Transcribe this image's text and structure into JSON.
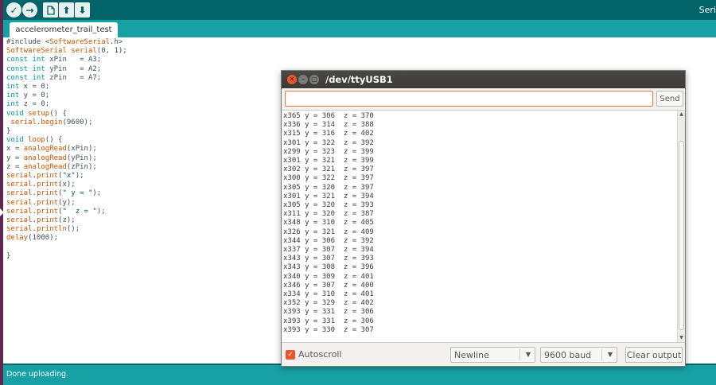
{
  "window": {
    "title_fragment": "Seri"
  },
  "toolbar": {
    "verify_icon": "check-icon",
    "upload_icon": "arrow-right-icon",
    "new_icon": "new-file-icon",
    "open_icon": "arrow-up-icon",
    "save_icon": "arrow-down-icon"
  },
  "tabs": [
    {
      "label": "accelerometer_trail_test"
    }
  ],
  "editor": {
    "code_lines": [
      "#include <SoftwareSerial.h>",
      "SoftwareSerial serial(0, 1);",
      "const int xPin   = A3;",
      "const int yPin   = A2;",
      "const int zPin   = A7;",
      "int x = 0;",
      "int y = 0;",
      "int z = 0;",
      "void setup() {",
      " serial.begin(9600);",
      "}",
      "void loop() {",
      "x = analogRead(xPin);",
      "y = analogRead(yPin);",
      "z = analogRead(zPin);",
      "serial.print(\"x\");",
      "serial.print(x);",
      "serial.print(\" y = \");",
      "serial.print(y);",
      "serial.print(\"  z = \");",
      "serial.print(z);",
      "serial.println();",
      "delay(1000);",
      "",
      "}"
    ]
  },
  "status": {
    "message": "Done uploading."
  },
  "serial_monitor": {
    "title": "/dev/ttyUSB1",
    "input": {
      "value": "",
      "placeholder": ""
    },
    "send_label": "Send",
    "output_lines": [
      "x365 y = 306  z = 370",
      "x336 y = 314  z = 388",
      "x315 y = 316  z = 402",
      "x301 y = 322  z = 392",
      "x299 y = 323  z = 399",
      "x301 y = 321  z = 399",
      "x302 y = 321  z = 397",
      "x300 y = 322  z = 397",
      "x305 y = 320  z = 397",
      "x301 y = 321  z = 394",
      "x305 y = 320  z = 393",
      "x311 y = 320  z = 387",
      "x348 y = 310  z = 405",
      "x326 y = 321  z = 409",
      "x344 y = 306  z = 392",
      "x337 y = 307  z = 394",
      "x343 y = 307  z = 393",
      "x343 y = 308  z = 396",
      "x340 y = 309  z = 401",
      "x346 y = 307  z = 400",
      "x334 y = 310  z = 401",
      "x352 y = 329  z = 402",
      "x393 y = 331  z = 306",
      "x393 y = 331  z = 306",
      "x393 y = 330  z = 307"
    ],
    "autoscroll": {
      "label": "Autoscroll",
      "checked": true
    },
    "line_ending": "Newline",
    "baud": "9600 baud",
    "clear_label": "Clear output"
  },
  "colors": {
    "toolbar": "#006468",
    "tabbar": "#17a1a5",
    "accent": "#e9572b",
    "keyword": "#00979c",
    "library": "#d35400"
  }
}
